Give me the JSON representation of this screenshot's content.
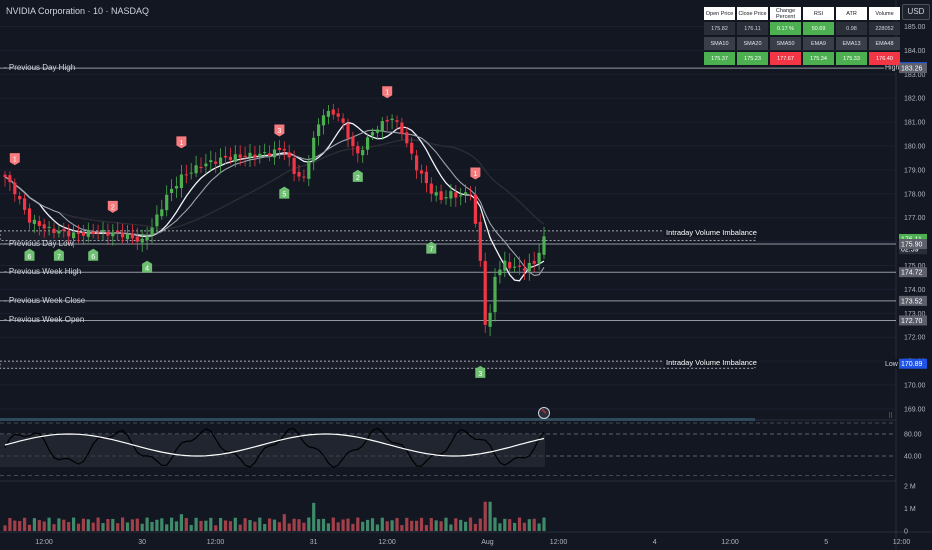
{
  "header": {
    "symbol_title": "NVIDIA Corporation · 10 · NASDAQ",
    "currency": "USD"
  },
  "stats_table": {
    "row1_headers": [
      "Open Price",
      "Close Price",
      "Change Percent",
      "RSI",
      "ATR",
      "Volume"
    ],
    "row1_values": [
      "175.82",
      "176.11",
      "0.17 %",
      "50.69",
      "0.98",
      "228052"
    ],
    "row1_value_styles": [
      "val",
      "val",
      "pos",
      "pos",
      "val",
      "val"
    ],
    "row2_headers": [
      "SMA10",
      "SMA20",
      "SMA50",
      "EMA9",
      "EMA13",
      "EMA48"
    ],
    "row2_values": [
      "175.37",
      "175.23",
      "177.67",
      "175.34",
      "175.33",
      "176.40"
    ],
    "row2_value_styles": [
      "pos",
      "pos",
      "neg",
      "pos",
      "pos",
      "neg"
    ]
  },
  "levels": [
    {
      "label": "Previous Day High",
      "price": 183.26
    },
    {
      "label": "Previous Day Low",
      "price": 175.9
    },
    {
      "label": "Previous Week High",
      "price": 174.72
    },
    {
      "label": "Previous Week Close",
      "price": 173.52
    },
    {
      "label": "Previous Week Open",
      "price": 172.7
    }
  ],
  "imbalances": [
    {
      "label": "Intraday Volume Imbalance",
      "top": 176.45,
      "bottom": 176.05
    },
    {
      "label": "Intraday Volume Imbalance",
      "top": 171.0,
      "bottom": 170.7
    }
  ],
  "price_tags": [
    {
      "text": "High",
      "price": 183.3,
      "color": "#1e53e5",
      "wide": true,
      "value": "183.30"
    },
    {
      "text": "183.26",
      "price": 183.26,
      "color": "#5d606b"
    },
    {
      "text": "176.11",
      "price": 176.11,
      "color": "#4caf50"
    },
    {
      "text": "02:59",
      "price": 175.68,
      "color": "#2a2e39"
    },
    {
      "text": "175.90",
      "price": 175.9,
      "color": "#5d606b"
    },
    {
      "text": "174.72",
      "price": 174.72,
      "color": "#5d606b"
    },
    {
      "text": "173.52",
      "price": 173.52,
      "color": "#5d606b"
    },
    {
      "text": "172.70",
      "price": 172.7,
      "color": "#5d606b"
    },
    {
      "text": "Low",
      "price": 170.89,
      "color": "#1e53e5",
      "wide": true,
      "value": "170.89"
    }
  ],
  "chart_data": {
    "type": "candlestick",
    "title": "NVIDIA Corporation · 10 · NASDAQ",
    "price_axis": {
      "ticks": [
        "185.00",
        "184.00",
        "183.00",
        "182.00",
        "181.00",
        "180.00",
        "179.00",
        "178.00",
        "177.00",
        "176.00",
        "175.00",
        "174.00",
        "173.00",
        "172.00",
        "171.00",
        "170.00",
        "169.00"
      ],
      "ylim": [
        168.5,
        185.4
      ]
    },
    "time_axis": {
      "ticks": [
        "12:00",
        "30",
        "12:00",
        "31",
        "12:00",
        "Aug",
        "12:00",
        "4",
        "12:00",
        "5",
        "12:00"
      ],
      "tick_index": [
        7,
        28,
        42,
        63,
        77,
        98,
        112,
        133,
        147,
        168,
        182
      ]
    },
    "bars_shown": 111,
    "close_anchors": [
      [
        0,
        178.7
      ],
      [
        2,
        178.1
      ],
      [
        5,
        176.9
      ],
      [
        9,
        176.5
      ],
      [
        14,
        176.3
      ],
      [
        19,
        176.4
      ],
      [
        24,
        176.3
      ],
      [
        28,
        176.0
      ],
      [
        30,
        176.6
      ],
      [
        33,
        177.9
      ],
      [
        36,
        178.7
      ],
      [
        40,
        179.2
      ],
      [
        45,
        179.5
      ],
      [
        50,
        179.6
      ],
      [
        54,
        179.7
      ],
      [
        57,
        179.9
      ],
      [
        59,
        178.9
      ],
      [
        61,
        178.6
      ],
      [
        63,
        180.3
      ],
      [
        65,
        181.4
      ],
      [
        68,
        181.3
      ],
      [
        70,
        180.4
      ],
      [
        72,
        179.6
      ],
      [
        74,
        180.3
      ],
      [
        76,
        180.8
      ],
      [
        79,
        181.2
      ],
      [
        81,
        180.6
      ],
      [
        84,
        179.1
      ],
      [
        87,
        178.1
      ],
      [
        89,
        177.8
      ],
      [
        91,
        178.0
      ],
      [
        93,
        177.9
      ],
      [
        95,
        178.1
      ],
      [
        97,
        175.2
      ],
      [
        98,
        172.6
      ],
      [
        99,
        172.9
      ],
      [
        100,
        174.6
      ],
      [
        102,
        175.1
      ],
      [
        104,
        174.9
      ],
      [
        106,
        174.9
      ],
      [
        108,
        175.1
      ],
      [
        110,
        176.1
      ]
    ],
    "price_markers": [
      {
        "label": "1",
        "bar": 2,
        "price": 179.2,
        "kind": "sell"
      },
      {
        "label": "6",
        "bar": 5,
        "price": 175.7,
        "kind": "buy"
      },
      {
        "label": "7",
        "bar": 11,
        "price": 175.7,
        "kind": "buy"
      },
      {
        "label": "6",
        "bar": 18,
        "price": 175.7,
        "kind": "buy"
      },
      {
        "label": "2",
        "bar": 22,
        "price": 177.2,
        "kind": "sell"
      },
      {
        "label": "4",
        "bar": 29,
        "price": 175.2,
        "kind": "buy"
      },
      {
        "label": "1",
        "bar": 36,
        "price": 179.9,
        "kind": "sell"
      },
      {
        "label": "3",
        "bar": 56,
        "price": 180.4,
        "kind": "sell"
      },
      {
        "label": "5",
        "bar": 57,
        "price": 178.3,
        "kind": "buy"
      },
      {
        "label": "2",
        "bar": 72,
        "price": 179.0,
        "kind": "buy"
      },
      {
        "label": "1",
        "bar": 78,
        "price": 182.0,
        "kind": "sell"
      },
      {
        "label": "7",
        "bar": 87,
        "price": 176.0,
        "kind": "buy"
      },
      {
        "label": "1",
        "bar": 96,
        "price": 178.6,
        "kind": "sell"
      },
      {
        "label": "3",
        "bar": 97,
        "price": 170.8,
        "kind": "buy"
      }
    ],
    "oscillator": {
      "ticks": [
        "80.00",
        "40.00"
      ],
      "ylim": [
        0,
        100
      ]
    },
    "volume": {
      "ticks": [
        "2 M",
        "1 M",
        "0"
      ],
      "ylim": [
        0,
        2000000
      ]
    }
  }
}
